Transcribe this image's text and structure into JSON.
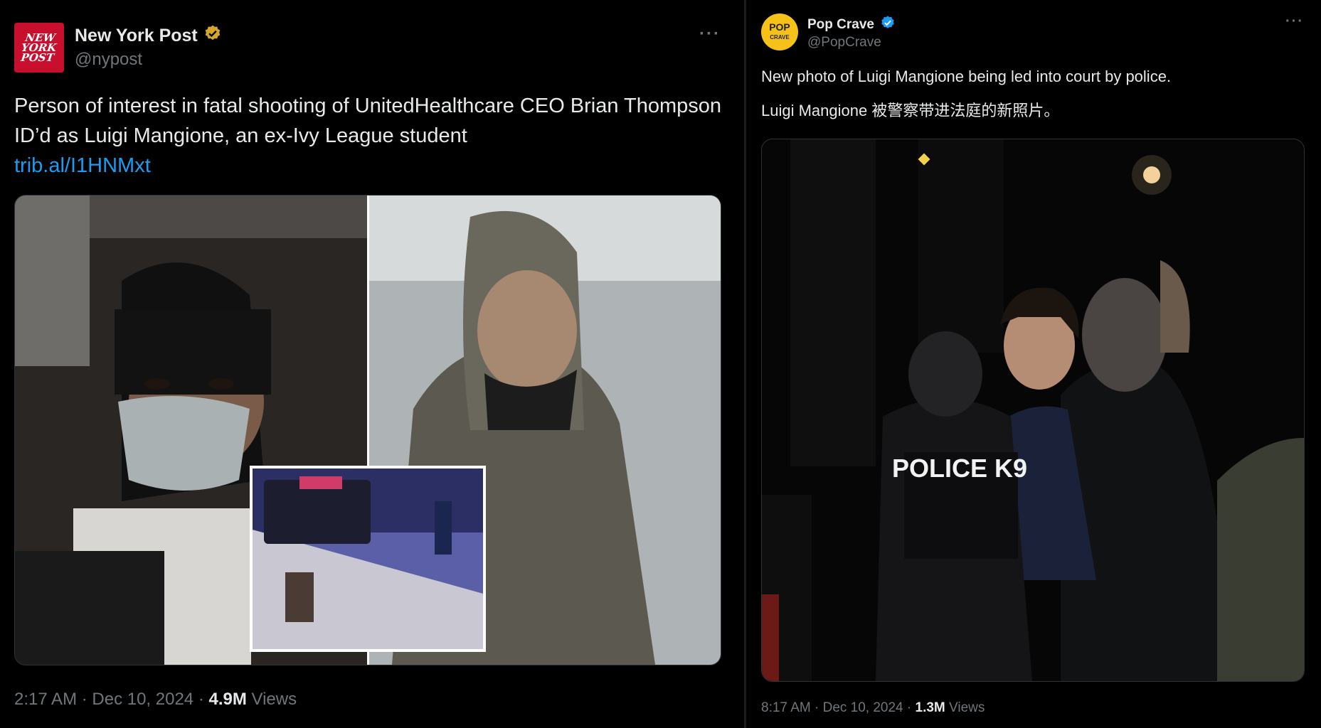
{
  "left_tweet": {
    "author_name": "New York Post",
    "author_handle": "@nypost",
    "avatar_text": "NEW YORK POST",
    "badge_color": "#d4a72c",
    "text": "Person of interest in fatal shooting of UnitedHealthcare CEO Brian Thompson ID’d as Luigi Mangione, an ex-Ivy League student",
    "link": "trib.al/I1HNMxt",
    "time": "2:17 AM · Dec 10, 2024 · ",
    "views_count": "4.9M",
    "views_label": " Views",
    "more_icon": "more-horizontal-icon"
  },
  "right_tweet": {
    "author_name": "Pop Crave",
    "author_handle": "@PopCrave",
    "avatar_text": "POP CRAVE",
    "badge_color": "#1d9bf0",
    "text_en": "New photo of Luigi Mangione being led into court by police.",
    "text_zh": "Luigi Mangione 被警察带进法庭的新照片。",
    "photo_vest_text": "POLICE K9",
    "time": "8:17 AM · Dec 10, 2024 · ",
    "views_count": "1.3M",
    "views_label": " Views",
    "more_icon": "more-horizontal-icon"
  },
  "colors": {
    "background": "#000000",
    "text": "#e7e9ea",
    "muted": "#71767b",
    "link": "#1d9bf0",
    "nypost_red": "#c8102e",
    "popcrave_yellow": "#f6c21a"
  }
}
